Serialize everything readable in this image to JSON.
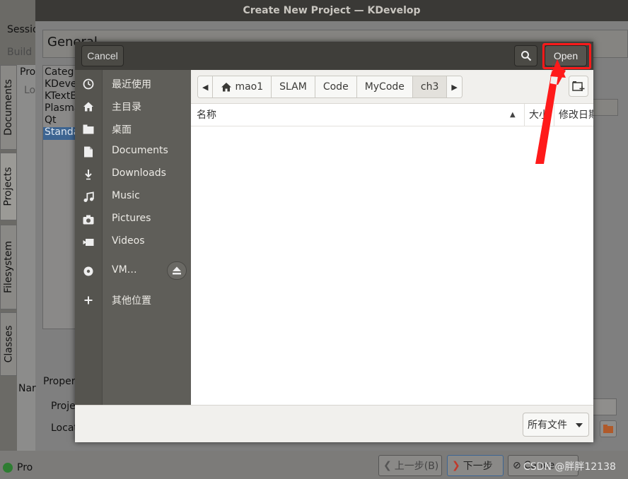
{
  "window": {
    "title": "Create New Project — KDevelop",
    "menu_partial": "Sessio",
    "toolbar_partial": "Build",
    "vertical_tabs": [
      "Documents",
      "Projects",
      "Filesystem",
      "Classes"
    ],
    "general_header": "General",
    "left_list_header": "Pro",
    "left_list_item": "Lo",
    "category_header": "Categ",
    "categories": [
      "KDeve",
      "KTextE",
      "Plasma",
      "Qt",
      "Standa"
    ],
    "properties_label": "Proper",
    "name_label": "Nar",
    "project_label": "Proje",
    "location_label": "Locat",
    "bottom_left": "Pro",
    "back_button": "上一步(B)",
    "next_button": "下一步",
    "cancel_partial": "Cance"
  },
  "dialog": {
    "cancel_label": "Cancel",
    "open_label": "Open",
    "search_icon": "search-icon",
    "sidebar": [
      {
        "icon": "clock-icon",
        "label": "最近使用"
      },
      {
        "icon": "home-icon",
        "label": "主目录"
      },
      {
        "icon": "folder-icon",
        "label": "桌面"
      },
      {
        "icon": "document-icon",
        "label": "Documents"
      },
      {
        "icon": "download-icon",
        "label": "Downloads"
      },
      {
        "icon": "music-icon",
        "label": "Music"
      },
      {
        "icon": "camera-icon",
        "label": "Pictures"
      },
      {
        "icon": "video-icon",
        "label": "Videos"
      },
      {
        "icon": "disc-icon",
        "label": "VM…"
      },
      {
        "icon": "plus-icon",
        "label": "其他位置"
      }
    ],
    "breadcrumbs": [
      "mao1",
      "SLAM",
      "Code",
      "MyCode",
      "ch3"
    ],
    "active_crumb": "ch3",
    "columns": {
      "name": "名称",
      "size": "大小",
      "modified": "修改日期"
    },
    "filter": "所有文件"
  },
  "watermark": "CSDN @胖胖12138",
  "colors": {
    "highlight": "#ff1a1a",
    "sidebar": "#5f5e59",
    "header": "#3f3e3a",
    "selection": "#3d6592"
  }
}
